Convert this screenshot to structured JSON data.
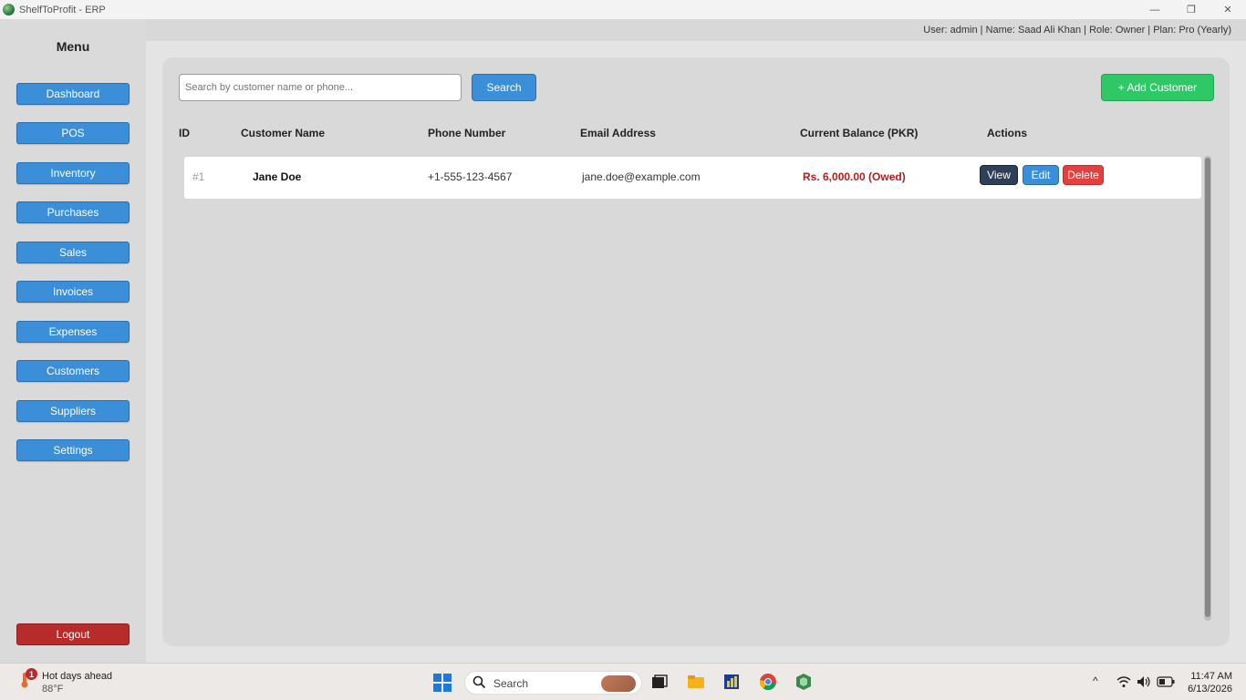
{
  "window": {
    "title": "ShelfToProfit - ERP",
    "minimize_glyph": "—",
    "restore_glyph": "❐",
    "close_glyph": "✕"
  },
  "sidebar": {
    "title": "Menu",
    "items": [
      {
        "label": "Dashboard"
      },
      {
        "label": "POS"
      },
      {
        "label": "Inventory"
      },
      {
        "label": "Purchases"
      },
      {
        "label": "Sales"
      },
      {
        "label": "Invoices"
      },
      {
        "label": "Expenses"
      },
      {
        "label": "Customers"
      },
      {
        "label": "Suppliers"
      },
      {
        "label": "Settings"
      }
    ],
    "logout_label": "Logout"
  },
  "header": {
    "user_info": "User: admin | Name: Saad Ali Khan | Role: Owner | Plan: Pro (Yearly)"
  },
  "toolbar": {
    "search_placeholder": "Search by customer name or phone...",
    "search_label": "Search",
    "add_label": "+ Add Customer"
  },
  "table": {
    "columns": [
      "ID",
      "Customer Name",
      "Phone Number",
      "Email Address",
      "Current Balance (PKR)",
      "Actions"
    ],
    "rows": [
      {
        "id": "#1",
        "name": "Jane Doe",
        "phone": "+1-555-123-4567",
        "email": "jane.doe@example.com",
        "balance": "Rs. 6,000.00 (Owed)",
        "actions": [
          "View",
          "Edit",
          "Delete"
        ]
      }
    ]
  },
  "taskbar": {
    "weather_badge": "1",
    "weather_text": "Hot days ahead",
    "weather_temp": "88°F",
    "search_label": "Search",
    "time": "11:47 AM",
    "date": "6/13/2026",
    "icons": [
      "start-icon",
      "search-icon",
      "task-view-icon",
      "file-explorer-icon",
      "power-bi-icon",
      "chrome-icon",
      "app-icon",
      "chevron-up-icon",
      "wifi-icon",
      "volume-icon",
      "battery-icon"
    ]
  },
  "colors": {
    "primary": "#3a8fd8",
    "success": "#2ec866",
    "danger": "#e54040",
    "logout": "#b72b2b",
    "owed": "#b11e1e",
    "dark": "#2f3f57"
  }
}
